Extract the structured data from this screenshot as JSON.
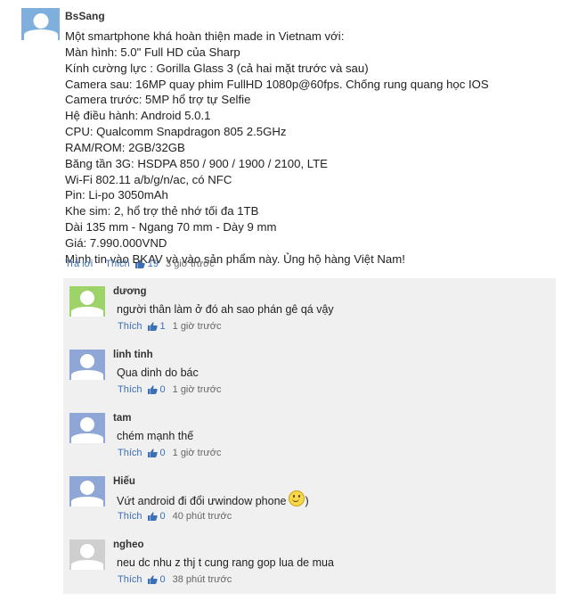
{
  "main_comment": {
    "author": "BsSang",
    "lines": [
      "Một smartphone khá hoàn thiện made in Vietnam với:",
      "Màn hình: 5.0\" Full HD của Sharp",
      "Kính cường lực : Gorilla Glass 3 (cả hai mặt trước và sau)",
      "Camera sau: 16MP quay phim FullHD 1080p@60fps. Chống rung quang học IOS",
      "Camera trước: 5MP hổ trợ tự Selfie",
      "Hệ điều hành: Android 5.0.1",
      "CPU: Qualcomm Snapdragon 805 2.5GHz",
      "RAM/ROM: 2GB/32GB",
      "Băng tần 3G: HSDPA 850 / 900 / 1900 / 2100, LTE",
      "Wi-Fi 802.11 a/b/g/n/ac, có NFC",
      "Pin: Li-po 3050mAh",
      "Khe sim: 2, hổ trợ thẻ nhớ tối đa 1TB",
      "Dài 135 mm - Ngang 70 mm - Dày 9 mm",
      "Giá: 7.990.000VND",
      "Mình tin vào BKAV và vào sản phẩm này. Ủng hộ hàng Việt Nam!"
    ],
    "reply_label": "Trả lời",
    "like_label": "Thích",
    "likes": "19",
    "time": "3 giờ trước",
    "avatar_icon": "default-user-avatar-icon"
  },
  "replies": [
    {
      "author": "dương",
      "text": "người thân làm ở đó ah sao phán gê qá vậy",
      "like_label": "Thích",
      "likes": "1",
      "time": "1 giờ trước",
      "avatar_color": "#9ed36a"
    },
    {
      "author": "linh tinh",
      "text": "Qua dinh do bác",
      "like_label": "Thích",
      "likes": "0",
      "time": "1 giờ trước",
      "avatar_color": "#8fa7d6"
    },
    {
      "author": "tam",
      "text": "chém mạnh thế",
      "like_label": "Thích",
      "likes": "0",
      "time": "1 giờ trước",
      "avatar_color": "#8fa7d6"
    },
    {
      "author": "Hiếu",
      "text": "Vứt android đi đổi ưwindow phone",
      "text_suffix": ")",
      "has_smiley": true,
      "like_label": "Thích",
      "likes": "0",
      "time": "40 phút trước",
      "avatar_color": "#8fa7d6"
    },
    {
      "author": "ngheo",
      "text": "neu dc nhu z thj t cung rang gop lua de mua",
      "like_label": "Thích",
      "likes": "0",
      "time": "38 phút trước",
      "avatar_color": "#cfcfcf"
    }
  ],
  "colors": {
    "link": "#3b6fb6",
    "reply_background": "#f0f0f0"
  }
}
